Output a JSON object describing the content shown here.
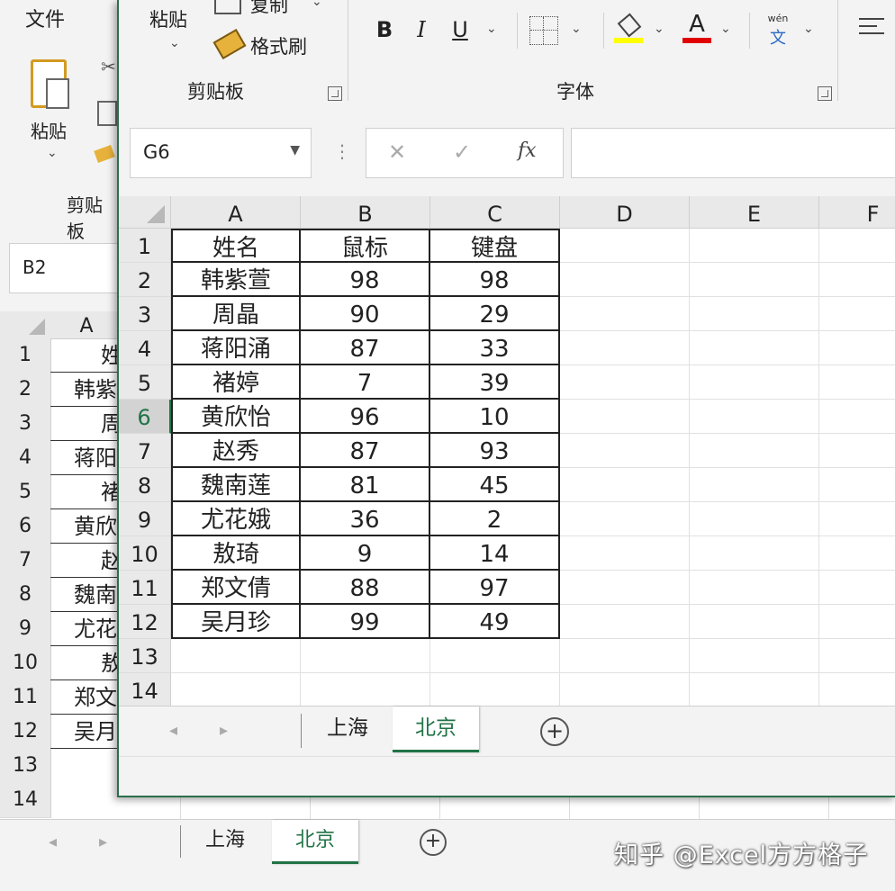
{
  "back": {
    "tab_file": "文件",
    "paste_label": "粘贴",
    "group_label": "剪贴板",
    "namebox": "B2",
    "col_header": "A",
    "row_numbers": [
      "1",
      "2",
      "3",
      "4",
      "5",
      "6",
      "7",
      "8",
      "9",
      "10",
      "11",
      "12",
      "13",
      "14"
    ],
    "col_a_partial": [
      "姓",
      "韩紫",
      "周",
      "蒋阳",
      "褚",
      "黄欣",
      "赵",
      "魏南",
      "尤花",
      "敖",
      "郑文",
      "吴月"
    ],
    "sheets": [
      "上海",
      "北京"
    ],
    "active_sheet": "北京"
  },
  "ribbon": {
    "paste_label": "粘贴",
    "copy_label": "复制",
    "format_painter_label": "格式刷",
    "clipboard_group": "剪贴板",
    "bold": "B",
    "italic": "I",
    "underline": "U",
    "font_color_letter": "A",
    "phonetic_top": "wén",
    "phonetic_bottom": "文",
    "font_group": "字体",
    "fill_color": "#ffff00",
    "font_color": "#e00000"
  },
  "formula_bar": {
    "namebox": "G6",
    "cancel": "✕",
    "enter": "✓",
    "fx": "fx",
    "value": ""
  },
  "grid": {
    "columns": [
      "A",
      "B",
      "C",
      "D",
      "E",
      "F"
    ],
    "row_numbers": [
      "1",
      "2",
      "3",
      "4",
      "5",
      "6",
      "7",
      "8",
      "9",
      "10",
      "11",
      "12",
      "13",
      "14"
    ],
    "selected_row": "6",
    "header": [
      "姓名",
      "鼠标",
      "键盘"
    ],
    "rows": [
      [
        "韩紫萱",
        "98",
        "98"
      ],
      [
        "周晶",
        "90",
        "29"
      ],
      [
        "蒋阳涌",
        "87",
        "33"
      ],
      [
        "褚婷",
        "7",
        "39"
      ],
      [
        "黄欣怡",
        "96",
        "10"
      ],
      [
        "赵秀",
        "87",
        "93"
      ],
      [
        "魏南莲",
        "81",
        "45"
      ],
      [
        "尤花娥",
        "36",
        "2"
      ],
      [
        "敖琦",
        "9",
        "14"
      ],
      [
        "郑文倩",
        "88",
        "97"
      ],
      [
        "吴月珍",
        "99",
        "49"
      ]
    ]
  },
  "sheets": {
    "tabs": [
      "上海",
      "北京"
    ],
    "active": "北京",
    "add": "+"
  },
  "watermark": "知乎 @Excel方方格子"
}
